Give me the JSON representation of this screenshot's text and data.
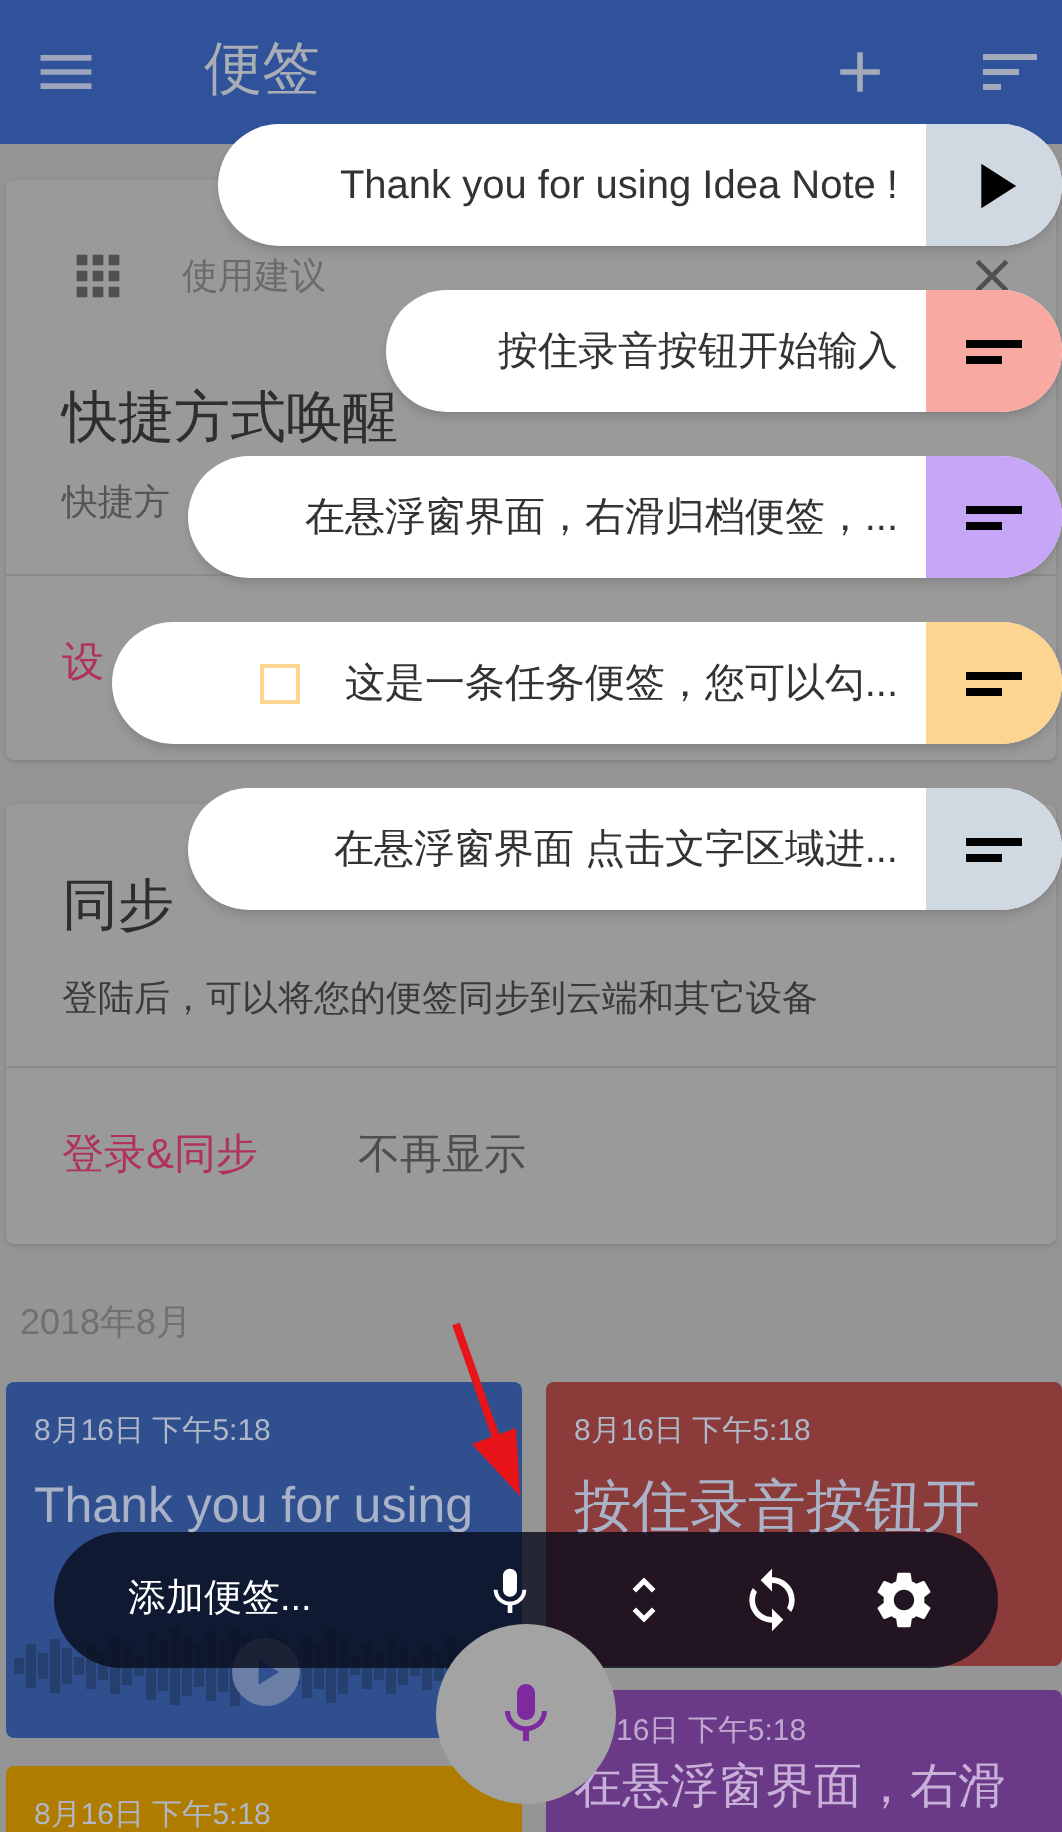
{
  "app_bar": {
    "title": "便签"
  },
  "tip_card": {
    "category": "使用建议",
    "title": "快捷方式唤醒",
    "description": "快捷方",
    "action": "设"
  },
  "sync_card": {
    "title": "同步",
    "description": "登陆后，可以将您的便签同步到云端和其它设备",
    "actions": [
      {
        "label": "登录&同步",
        "kind": "primary"
      },
      {
        "label": "不再显示",
        "kind": "secondary"
      }
    ]
  },
  "section_header": "2018年8月",
  "notes": [
    {
      "date": "8月16日 下午5:18",
      "text": "Thank you for using",
      "color": "#2f4f8f",
      "kind": "audio"
    },
    {
      "date": "8月16日 下午5:18",
      "color": "#b07c00",
      "kind": "text"
    },
    {
      "date": "8月16日 下午5:18",
      "text": "按住录音按钮开",
      "color": "#8a3b3a",
      "kind": "text"
    },
    {
      "date": "16日 下午5:18",
      "text": "在悬浮窗界面，右滑",
      "color": "#6a3a88",
      "kind": "text"
    }
  ],
  "bubbles": [
    {
      "text": "Thank you for using Idea Note !",
      "kind": "play",
      "color": "#d0d9e1"
    },
    {
      "text": "按住录音按钮开始输入",
      "kind": "note",
      "color": "#f9a9a1"
    },
    {
      "text": "在悬浮窗界面，右滑归档便签，...",
      "kind": "note",
      "color": "#c7a6f7"
    },
    {
      "text": "这是一条任务便签，您可以勾...",
      "kind": "task",
      "checked": false,
      "color": "#fdd590"
    },
    {
      "text": "在悬浮窗界面 点击文字区域进...",
      "kind": "note",
      "color": "#d0d9e1"
    }
  ],
  "quick_bar": {
    "prompt": "添加便签..."
  }
}
